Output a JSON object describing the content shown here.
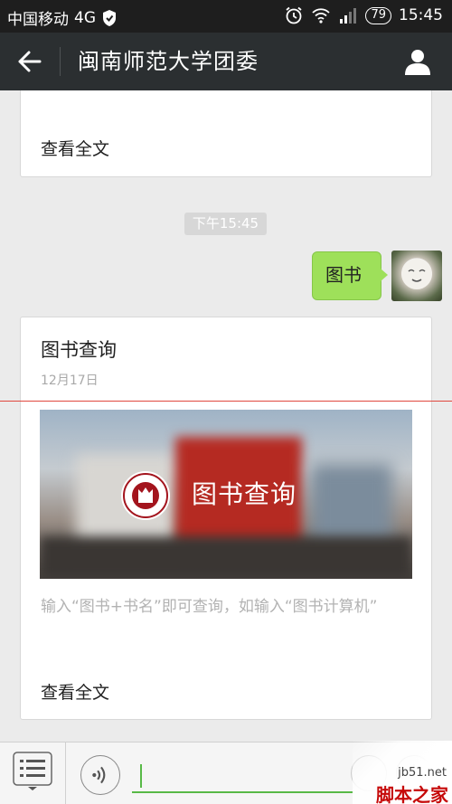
{
  "status_bar": {
    "carrier": "中国移动",
    "network": "4G",
    "battery": "79",
    "time": "15:45"
  },
  "nav": {
    "title": "闽南师范大学团委"
  },
  "prev_card": {
    "read_more": "查看全文"
  },
  "chat": {
    "timestamp": "下午15:45",
    "user_message": "图书"
  },
  "article": {
    "title": "图书查询",
    "date": "12月17日",
    "cover_text": "图书查询",
    "digest": "输入“图书+书名”即可查询，如输入“图书计算机”",
    "read_more": "查看全文"
  },
  "watermark": {
    "site": "jb51.net",
    "name": "脚本之家"
  },
  "colors": {
    "nav_bg": "#2b2f31",
    "bubble": "#9ee05a",
    "accent_line": "#e0483e",
    "input_underline": "#58b947"
  }
}
